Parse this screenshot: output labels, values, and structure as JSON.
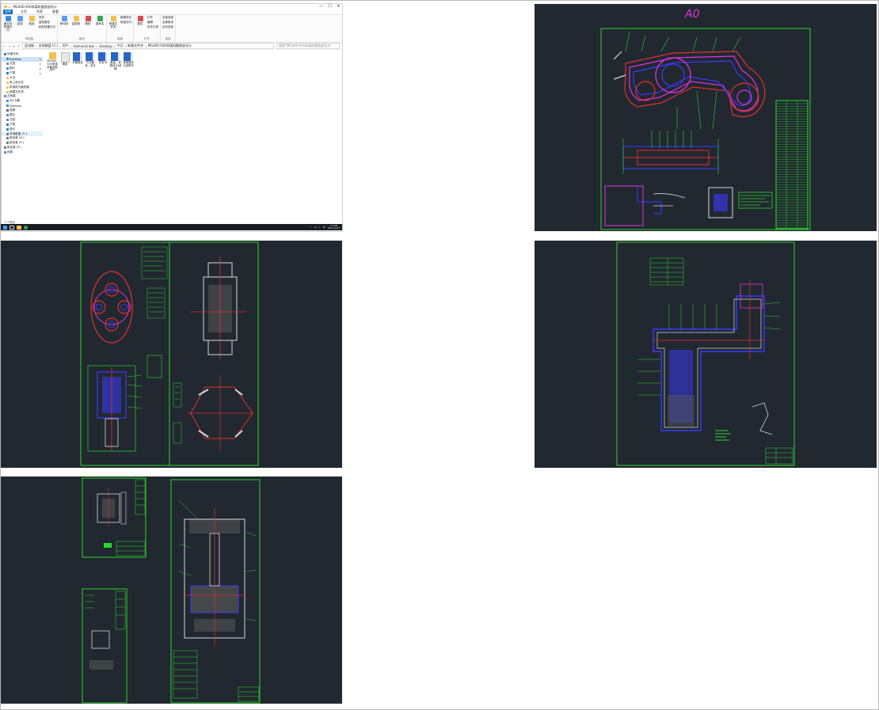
{
  "explorer": {
    "title": "MG400-930采煤机截割部设计",
    "window_controls": [
      "—",
      "☐",
      "✕"
    ],
    "menu_tabs": [
      "文件",
      "主页",
      "共享",
      "查看"
    ],
    "ribbon": {
      "groups": [
        {
          "label": "剪贴板",
          "big": [
            "固定到快速访问",
            "复制",
            "粘贴"
          ],
          "small": [
            "剪切",
            "复制路径",
            "粘贴快捷方式"
          ]
        },
        {
          "label": "组织",
          "big": [
            "移动到",
            "复制到",
            "删除",
            "重命名"
          ],
          "small": []
        },
        {
          "label": "新建",
          "big": [
            "新建文件夹"
          ],
          "small": [
            "新建项目",
            "轻松访问"
          ]
        },
        {
          "label": "打开",
          "big": [
            "属性"
          ],
          "small": [
            "打开",
            "编辑",
            "历史记录"
          ]
        },
        {
          "label": "选择",
          "big": [],
          "small": [
            "全部选择",
            "全部取消",
            "反向选择"
          ]
        }
      ]
    },
    "address": {
      "segments": [
        "此电脑",
        "本地磁盘 (C:)",
        "用户",
        "Administrator",
        "Desktop",
        "今日",
        "新建文件夹",
        "MG400-930采煤机截割部设计"
      ],
      "search_placeholder": "搜索\"MG400-930采煤机截割部设计\""
    },
    "sidebar": [
      {
        "label": "快速访问",
        "icon": "star-icon",
        "color": "#1c7bd6",
        "indent": 0
      },
      {
        "label": "Desktop",
        "icon": "desktop-icon",
        "color": "#3b8ee8",
        "indent": 1,
        "selected": true,
        "pinned": true
      },
      {
        "label": "文档",
        "icon": "document-icon",
        "color": "#7d8a96",
        "indent": 1,
        "pinned": true
      },
      {
        "label": "图片",
        "icon": "picture-icon",
        "color": "#3b8ee8",
        "indent": 1,
        "pinned": true
      },
      {
        "label": "下载",
        "icon": "download-icon",
        "color": "#1c7bd6",
        "indent": 1,
        "pinned": true
      },
      {
        "label": "今日",
        "icon": "folder-icon",
        "color": "#f2c14e",
        "indent": 1
      },
      {
        "label": "电上商文件",
        "icon": "folder-icon",
        "color": "#f2c14e",
        "indent": 1
      },
      {
        "label": "采煤机与截割部",
        "icon": "folder-icon",
        "color": "#f2c14e",
        "indent": 1
      },
      {
        "label": "新建文件夹",
        "icon": "folder-icon",
        "color": "#f2c14e",
        "indent": 1
      },
      {
        "label": "此电脑",
        "icon": "computer-icon",
        "color": "#3b8ee8",
        "indent": 0
      },
      {
        "label": "3D 对象",
        "icon": "cube-icon",
        "color": "#3b8ee8",
        "indent": 1
      },
      {
        "label": "Desktop",
        "icon": "desktop-icon",
        "color": "#3b8ee8",
        "indent": 1
      },
      {
        "label": "视频",
        "icon": "video-icon",
        "color": "#5a6470",
        "indent": 1
      },
      {
        "label": "图片",
        "icon": "picture-icon",
        "color": "#3b8ee8",
        "indent": 1
      },
      {
        "label": "文档",
        "icon": "document-icon",
        "color": "#7d8a96",
        "indent": 1
      },
      {
        "label": "下载",
        "icon": "download-icon",
        "color": "#1c7bd6",
        "indent": 1
      },
      {
        "label": "音乐",
        "icon": "music-icon",
        "color": "#1c7bd6",
        "indent": 1
      },
      {
        "label": "本地磁盘 (C:)",
        "icon": "drive-icon",
        "color": "#6c7a88",
        "indent": 1,
        "highlight": true
      },
      {
        "label": "新加卷 (D:)",
        "icon": "drive-icon",
        "color": "#6c7a88",
        "indent": 1
      },
      {
        "label": "新加卷 (E:)",
        "icon": "drive-icon",
        "color": "#6c7a88",
        "indent": 1
      },
      {
        "label": "新加卷 (F:)",
        "icon": "drive-icon",
        "color": "#6c7a88",
        "indent": 0
      },
      {
        "label": "网络",
        "icon": "network-icon",
        "color": "#3b8ee8",
        "indent": 0
      }
    ],
    "files": [
      {
        "name": "MG400-930采煤机截割部设计",
        "type": "folder"
      },
      {
        "name": "图纸",
        "type": "dwg-doc"
      },
      {
        "name": "开题报告",
        "type": "doc"
      },
      {
        "name": "外文翻译、译文",
        "type": "doc"
      },
      {
        "name": "任务书",
        "type": "doc"
      },
      {
        "name": "截齿、滚筒设计(说明)",
        "type": "doc"
      },
      {
        "name": "减速器设计说明书",
        "type": "doc"
      }
    ],
    "status_text": "7 个项目",
    "taskbar": {
      "apps": [
        "windows-logo-icon",
        "file-explorer-icon",
        "browser-icon",
        "app-icon"
      ],
      "tray": [
        "^",
        "⊡",
        "♪",
        "中"
      ],
      "time": "17:48",
      "date": "2021/1/23"
    }
  },
  "drawings": [
    {
      "id": "assembly-a0",
      "label": "A0"
    },
    {
      "id": "drum-sheet",
      "label": ""
    },
    {
      "id": "gearbox-sheet",
      "label": ""
    },
    {
      "id": "parts-sheet",
      "label": ""
    }
  ],
  "colors": {
    "cad_bg": "#212830",
    "frame_green": "#2dd52d",
    "line_blue": "#3a3aff",
    "line_magenta": "#e033e0",
    "line_red": "#e03030",
    "line_white": "#d8d8d8",
    "explorer_accent": "#1a6fd0"
  }
}
